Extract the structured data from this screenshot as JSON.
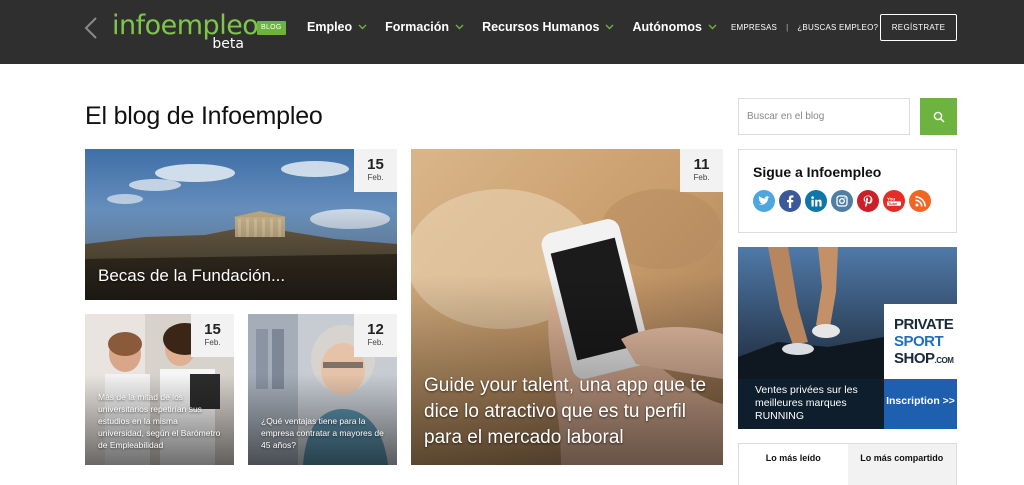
{
  "header": {
    "logo_text": "infoempleo",
    "logo_sub": "beta",
    "badge": "BLOG",
    "nav": [
      {
        "label": "Empleo"
      },
      {
        "label": "Formación"
      },
      {
        "label": "Recursos Humanos"
      },
      {
        "label": "Autónomos"
      }
    ],
    "links": {
      "empresas": "EMPRESAS",
      "separator": "|",
      "buscas": "¿BUSCAS EMPLEO?"
    },
    "register": "REGÍSTRATE"
  },
  "main": {
    "title": "El blog de Infoempleo",
    "posts": [
      {
        "day": "15",
        "month": "Feb.",
        "title": "Becas de la Fundación..."
      },
      {
        "day": "11",
        "month": "Feb.",
        "title": "Guide your talent, una app que te dice lo atractivo que es tu perfil para el mercado laboral"
      },
      {
        "day": "15",
        "month": "Feb.",
        "title": "Más de la mitad de los universitarios repetirían sus estudios en la misma universidad, según el Barómetro de Empleabilidad"
      },
      {
        "day": "12",
        "month": "Feb.",
        "title": "¿Qué ventajas tiene para la empresa contratar a mayores de 45 años?"
      }
    ]
  },
  "sidebar": {
    "search": {
      "placeholder": "Buscar en el blog",
      "icon": "search-icon"
    },
    "follow": {
      "title": "Sigue a Infoempleo",
      "networks": [
        {
          "name": "twitter-icon",
          "color": "#4da7de"
        },
        {
          "name": "facebook-icon",
          "color": "#3b5998"
        },
        {
          "name": "linkedin-icon",
          "color": "#0e76a8"
        },
        {
          "name": "instagram-icon",
          "color": "#517fa4"
        },
        {
          "name": "pinterest-icon",
          "color": "#cb2027"
        },
        {
          "name": "youtube-icon",
          "color": "#e52d27"
        },
        {
          "name": "rss-icon",
          "color": "#f26522"
        }
      ]
    },
    "ad": {
      "brand_1": "PRIVATE",
      "brand_2": "SPORT",
      "brand_3": "SHOP",
      "brand_3_suffix": ".COM",
      "text": "Ventes privées sur les meilleures marques RUNNING",
      "cta": "Inscription >>"
    },
    "tabs": [
      {
        "label": "Lo más leído"
      },
      {
        "label": "Lo más compartido"
      }
    ]
  },
  "colors": {
    "accent": "#6db33f",
    "header_bg": "#2f2f2f"
  }
}
